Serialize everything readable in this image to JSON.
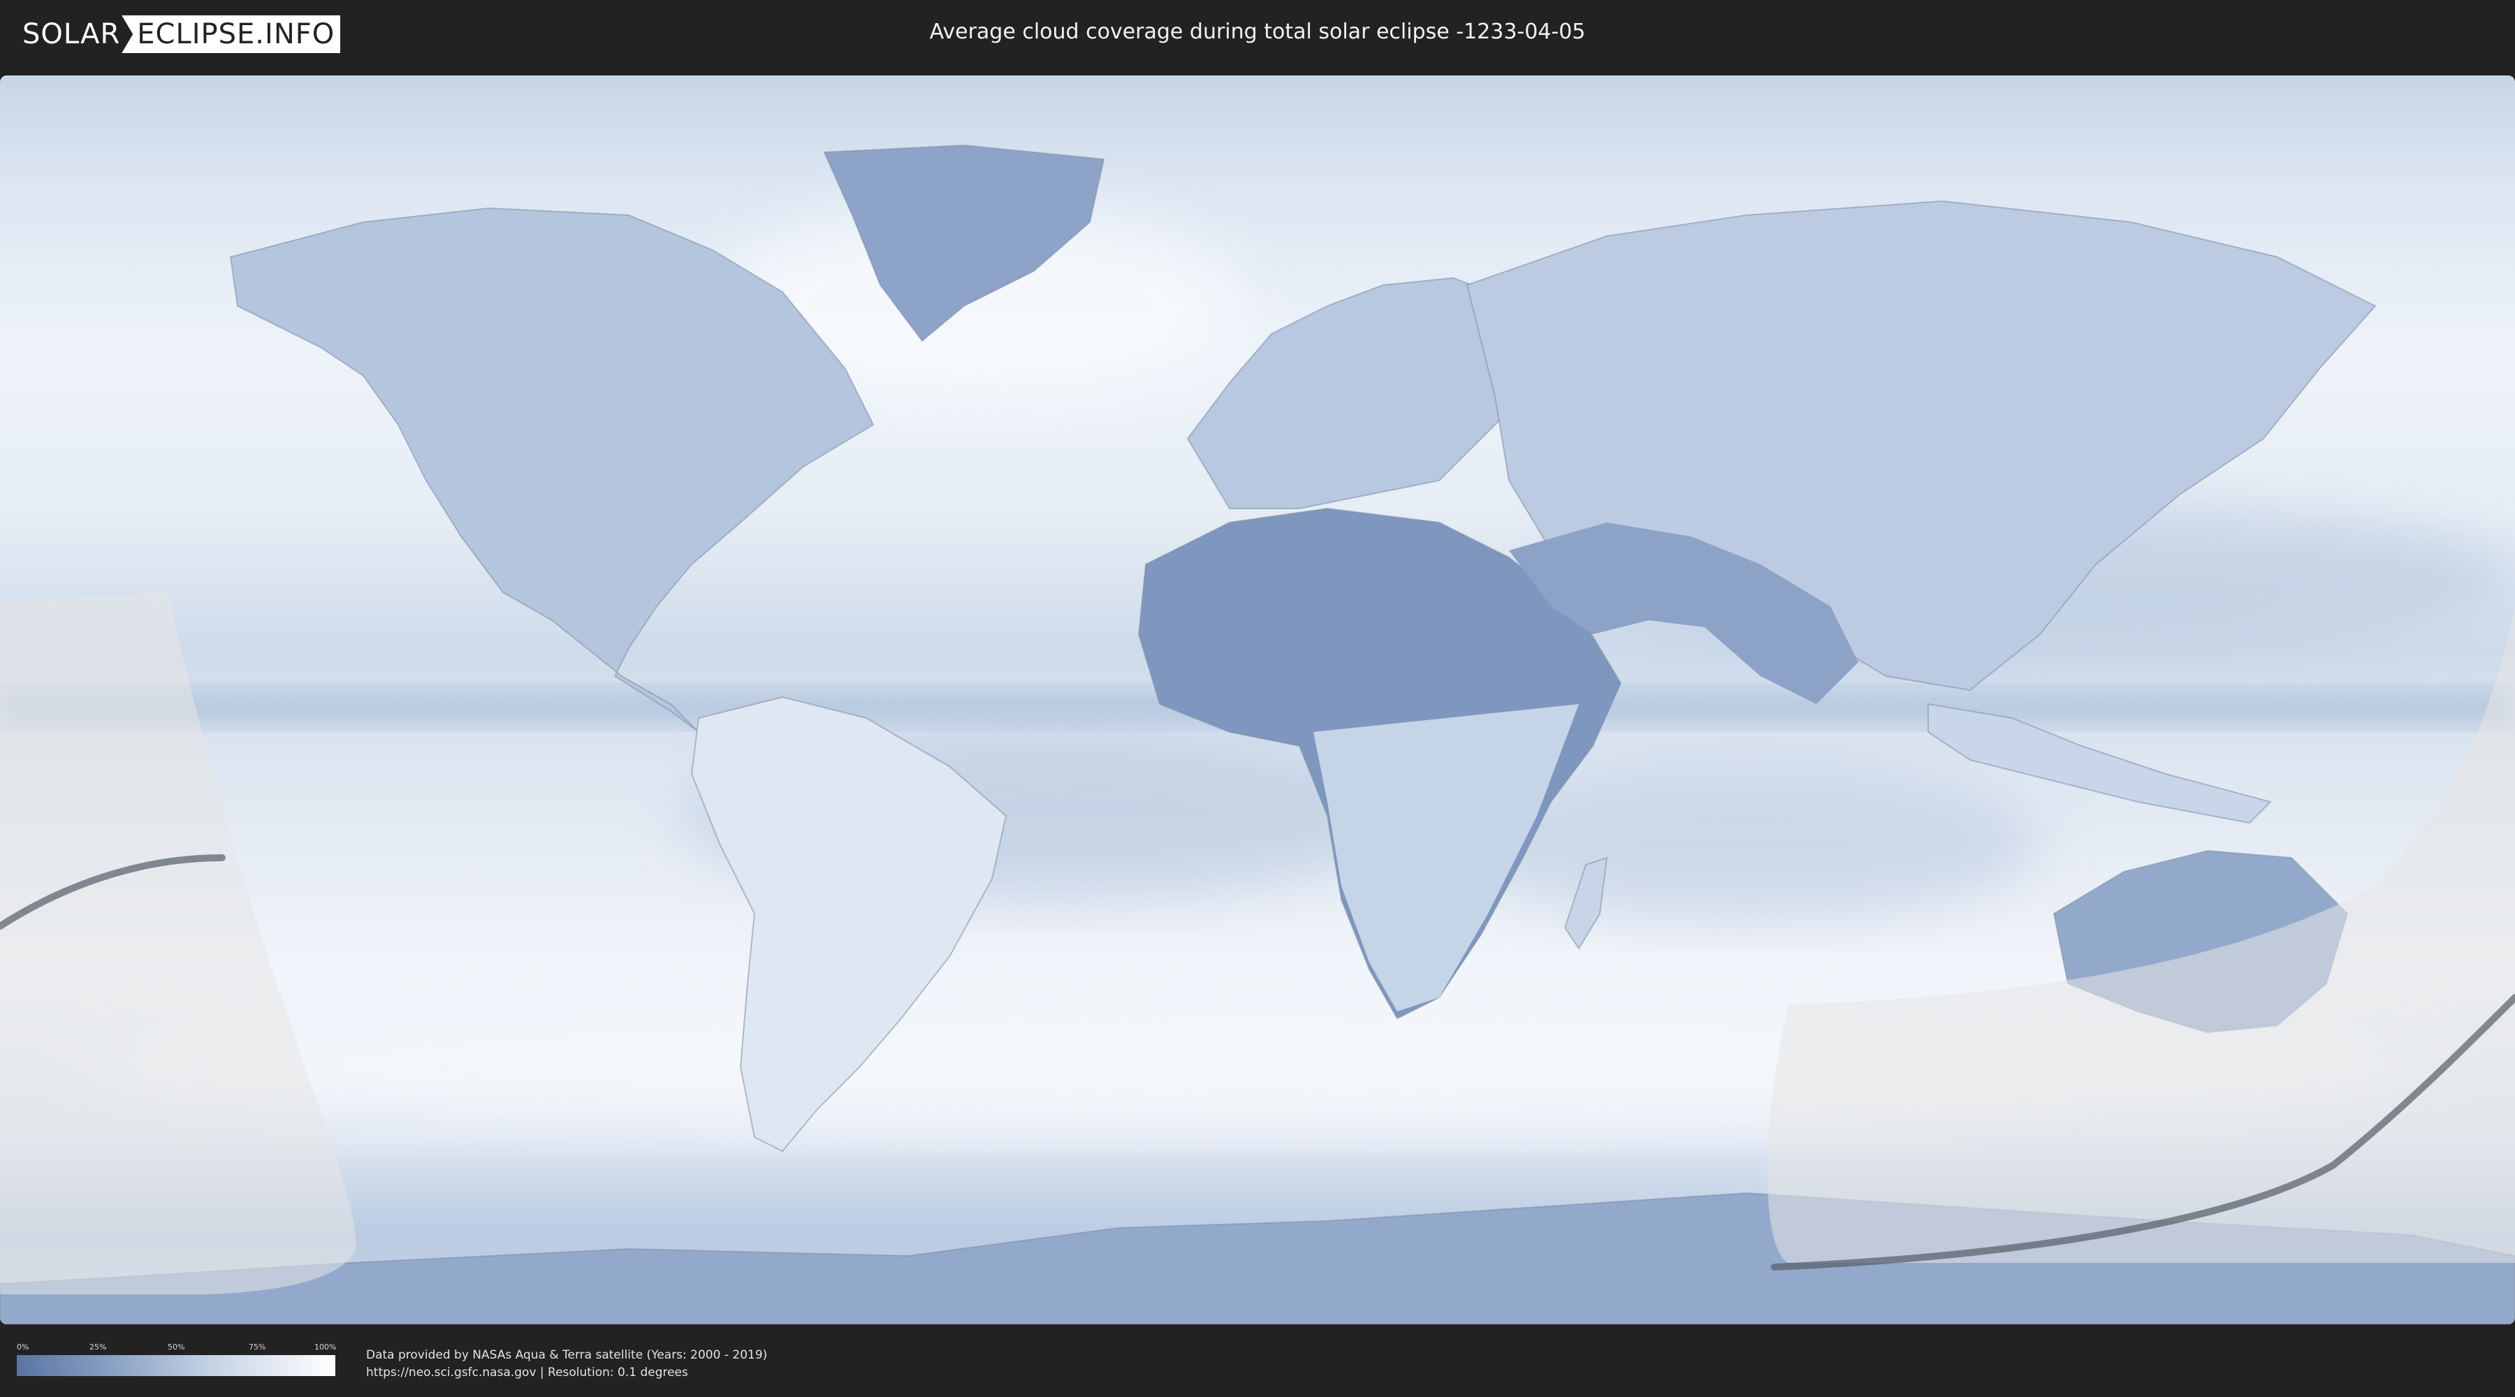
{
  "header": {
    "logo_left": "SOLAR",
    "logo_right": "ECLIPSE.INFO",
    "title": "Average cloud coverage during total solar eclipse -1233-04-05"
  },
  "legend": {
    "labels": [
      "0%",
      "25%",
      "50%",
      "75%",
      "100%"
    ],
    "color_low": "#5a74a4",
    "color_high": "#ffffff"
  },
  "footer": {
    "credit_line1": "Data provided by NASAs Aqua & Terra satellite (Years: 2000 - 2019)",
    "credit_line2": "https://neo.sci.gsfc.nasa.gov | Resolution: 0.1 degrees"
  },
  "map": {
    "projection": "equirectangular",
    "cloud_base_color": "#e9eff7",
    "land_clear_color": "#7f97bf",
    "eclipse_zone_color": "#e6e6e6",
    "path_color": "#555d68"
  }
}
